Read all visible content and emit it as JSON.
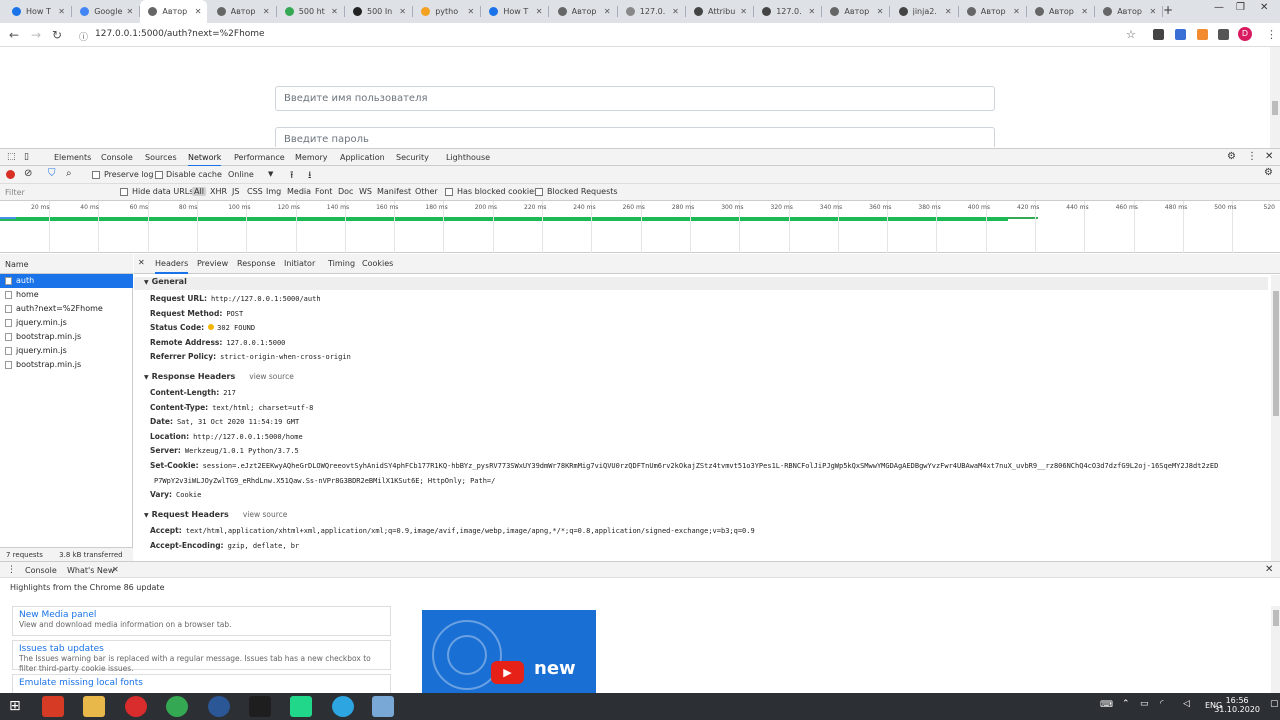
{
  "browser": {
    "tabs": [
      {
        "title": "How T",
        "icon": "edge-icon",
        "color": "#1a73e8"
      },
      {
        "title": "Google",
        "icon": "google-icon",
        "color": "#4285f4"
      },
      {
        "title": "Автор",
        "icon": "globe-icon",
        "color": "#666666",
        "active": true
      },
      {
        "title": "Автор",
        "icon": "globe-icon",
        "color": "#666666"
      },
      {
        "title": "500 ht",
        "icon": "google-icon",
        "color": "#34a853"
      },
      {
        "title": "500 In",
        "icon": "stackoverflow-icon",
        "color": "#222222"
      },
      {
        "title": "pytho",
        "icon": "pycharm-icon",
        "color": "#f4a020"
      },
      {
        "title": "How T",
        "icon": "edge-icon",
        "color": "#1a73e8"
      },
      {
        "title": "Автор",
        "icon": "globe-icon",
        "color": "#666666"
      },
      {
        "title": "127.0.",
        "icon": "globe-icon",
        "color": "#888888"
      },
      {
        "title": "Attribu",
        "icon": "docs-icon",
        "color": "#444444"
      },
      {
        "title": "127.0.",
        "icon": "docs-icon",
        "color": "#444444"
      },
      {
        "title": "Автор",
        "icon": "globe-icon",
        "color": "#666666"
      },
      {
        "title": "jinja2.",
        "icon": "docs-icon",
        "color": "#444444"
      },
      {
        "title": "Автор",
        "icon": "globe-icon",
        "color": "#666666"
      },
      {
        "title": "Автор",
        "icon": "globe-icon",
        "color": "#666666"
      },
      {
        "title": "Автор",
        "icon": "globe-icon",
        "color": "#666666"
      }
    ],
    "url": "127.0.0.1:5000/auth?next=%2Fhome",
    "profile_initial": "D"
  },
  "page": {
    "username_placeholder": "Введите имя пользователя",
    "password_placeholder": "Введите пароль"
  },
  "devtools": {
    "tabs": [
      "Elements",
      "Console",
      "Sources",
      "Network",
      "Performance",
      "Memory",
      "Application",
      "Security",
      "Lighthouse"
    ],
    "selected_tab": "Network",
    "toolbar": {
      "preserve_log": "Preserve log",
      "disable_cache": "Disable cache",
      "throttle": "Online"
    },
    "filter": {
      "placeholder": "Filter",
      "hide_data_urls": "Hide data URLs",
      "types": [
        "All",
        "XHR",
        "JS",
        "CSS",
        "Img",
        "Media",
        "Font",
        "Doc",
        "WS",
        "Manifest",
        "Other"
      ],
      "has_blocked_cookies": "Has blocked cookies",
      "blocked_requests": "Blocked Requests"
    },
    "timeline_ticks": [
      "20 ms",
      "40 ms",
      "60 ms",
      "80 ms",
      "100 ms",
      "120 ms",
      "140 ms",
      "160 ms",
      "180 ms",
      "200 ms",
      "220 ms",
      "240 ms",
      "260 ms",
      "280 ms",
      "300 ms",
      "320 ms",
      "340 ms",
      "360 ms",
      "380 ms",
      "400 ms",
      "420 ms",
      "440 ms",
      "460 ms",
      "480 ms",
      "500 ms",
      "520"
    ],
    "requests_header": "Name",
    "requests": [
      "auth",
      "home",
      "auth?next=%2Fhome",
      "jquery.min.js",
      "bootstrap.min.js",
      "jquery.min.js",
      "bootstrap.min.js"
    ],
    "footer": {
      "count": "7 requests",
      "transferred": "3.8 kB transferred"
    },
    "detail_tabs": [
      "Headers",
      "Preview",
      "Response",
      "Initiator",
      "Timing",
      "Cookies"
    ],
    "general_title": "General",
    "general": [
      {
        "k": "Request URL:",
        "v": "http://127.0.0.1:5000/auth"
      },
      {
        "k": "Request Method:",
        "v": "POST"
      },
      {
        "k": "Status Code:",
        "v": "302 FOUND"
      },
      {
        "k": "Remote Address:",
        "v": "127.0.0.1:5000"
      },
      {
        "k": "Referrer Policy:",
        "v": "strict-origin-when-cross-origin"
      }
    ],
    "response_title": "Response Headers",
    "view_source": "view source",
    "response": [
      {
        "k": "Content-Length:",
        "v": "217"
      },
      {
        "k": "Content-Type:",
        "v": "text/html; charset=utf-8"
      },
      {
        "k": "Date:",
        "v": "Sat, 31 Oct 2020 11:54:19 GMT"
      },
      {
        "k": "Location:",
        "v": "http://127.0.0.1:5000/home"
      },
      {
        "k": "Server:",
        "v": "Werkzeug/1.0.1 Python/3.7.5"
      },
      {
        "k": "Set-Cookie:",
        "v": "session=.eJzt2EEKwyAQheGrDLOWQreeovtSyhAnidSY4phFCb177R1KQ-hbBYz_pysRV773SWxUY39dmWr78KRmMig7viQVU0rzQDFTnUm6rv2kOkajZStz4tvmvt51o3YPes1L-RBNCFolJiPJgWp5kQxSMwwYMGDAgAEDBgwYvzFwr4UBAwaM4xt7nuX_uvbR9__rz806NChQ4cO3d7dzfG9L2oj-16SqeMY2J8dt2zED"
      },
      {
        "k": "",
        "v": "P7WpY2v3iWLJOyZwlTG9_eRhdLnw.X51Qaw.Ss-nVPr8G3BDR2eBMilX1KSut6E; HttpOnly; Path=/"
      },
      {
        "k": "Vary:",
        "v": "Cookie"
      }
    ],
    "request_title": "Request Headers",
    "request": [
      {
        "k": "Accept:",
        "v": "text/html,application/xhtml+xml,application/xml;q=0.9,image/avif,image/webp,image/apng,*/*;q=0.8,application/signed-exchange;v=b3;q=0.9"
      },
      {
        "k": "Accept-Encoding:",
        "v": "gzip, deflate, br"
      }
    ]
  },
  "drawer": {
    "tabs": [
      "Console",
      "What's New"
    ],
    "heading": "Highlights from the Chrome 86 update",
    "cards": [
      {
        "title": "New Media panel",
        "desc": "View and download media information on a browser tab."
      },
      {
        "title": "Issues tab updates",
        "desc": "The Issues warning bar is replaced with a regular message. Issues tab has a new checkbox to filter third-party cookie issues."
      },
      {
        "title": "Emulate missing local fonts",
        "desc": ""
      }
    ],
    "video_label": "new"
  },
  "taskbar": {
    "lang": "ENG",
    "time": "16:56",
    "date": "31.10.2020"
  },
  "colors": {
    "accent": "#1a73e8",
    "record": "#d93025",
    "status_dot": "#f4b400",
    "timeline_bar": "#1db954"
  }
}
